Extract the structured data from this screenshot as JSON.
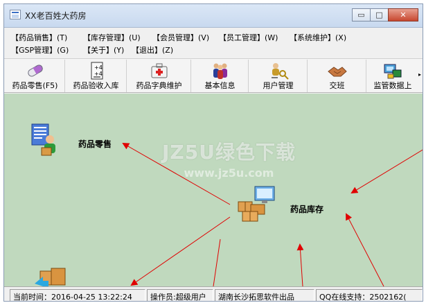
{
  "window": {
    "title": "XX老百姓大药房",
    "controls": {
      "minimize": "▭",
      "maximize": "□",
      "close": "✕"
    }
  },
  "menu": {
    "row1": [
      "【药品销售】(T)",
      "【库存管理】(U)",
      "【会员管理】(V)",
      "【员工管理】(W)",
      "【系统维护】(X)"
    ],
    "row2": [
      "【GSP管理】(G)",
      "【关于】(Y)",
      "【退出】(Z)"
    ]
  },
  "toolbar": {
    "items": [
      {
        "label": "药品零售(F5)",
        "icon": "pill-icon"
      },
      {
        "label": "药品验收入库",
        "icon": "calculator-icon"
      },
      {
        "label": "药品字典维护",
        "icon": "medical-kit-icon"
      },
      {
        "label": "基本信息",
        "icon": "people-icon"
      },
      {
        "label": "用户管理",
        "icon": "user-keys-icon"
      },
      {
        "label": "交班",
        "icon": "handshake-icon"
      },
      {
        "label": "监管数据上",
        "icon": "upload-icon"
      }
    ],
    "more": "▸"
  },
  "modules": {
    "retail": "药品零售",
    "inventory": "药品库存"
  },
  "watermark": {
    "line1": "JZ5U绿色下载",
    "line2": "www.jz5u.com"
  },
  "status": {
    "time": "当前时间：2016-04-25 13:22:24",
    "operator": "操作员:超级用户",
    "company": "湖南长沙拓思软件出品",
    "support": "QQ在线支持：2502162("
  },
  "colors": {
    "canvas": "#c0d9be",
    "arrow": "#e00000",
    "titlebar": "#c8d9ef"
  }
}
